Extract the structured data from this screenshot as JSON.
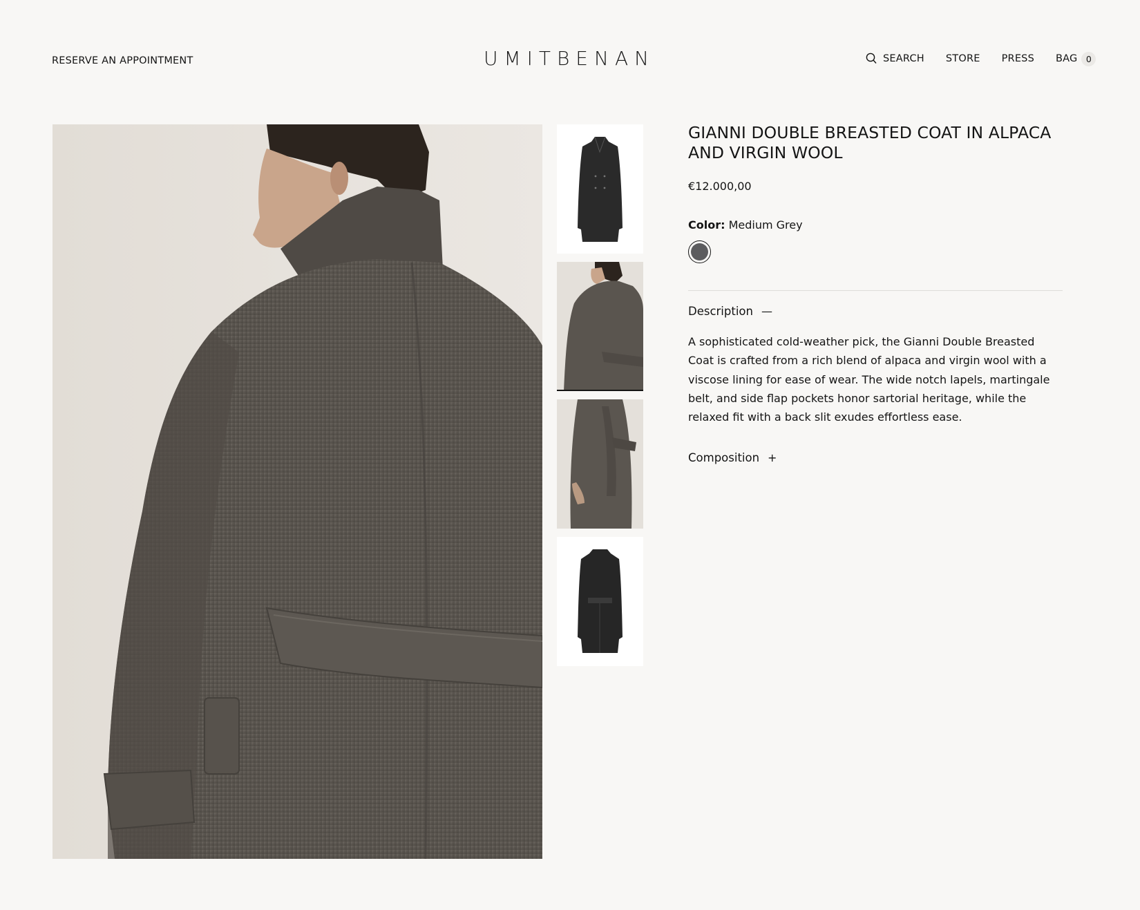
{
  "header": {
    "reserve_label": "RESERVE AN APPOINTMENT",
    "logo": "UMITBENAN",
    "nav": {
      "search_label": "SEARCH",
      "store_label": "STORE",
      "press_label": "PRESS",
      "bag_label": "BAG",
      "bag_count": "0"
    }
  },
  "gallery": {
    "main_image": "model-back-view-coat",
    "thumbnails": [
      {
        "name": "coat-front-flat"
      },
      {
        "name": "model-back-view",
        "active": true
      },
      {
        "name": "model-side-view"
      },
      {
        "name": "coat-back-flat"
      }
    ]
  },
  "product": {
    "title": "GIANNI DOUBLE BREASTED COAT IN ALPACA AND VIRGIN WOOL",
    "price": "€12.000,00",
    "color_label": "Color:",
    "color_value": "Medium Grey",
    "swatch_color": "#5c5c5e",
    "description": {
      "label": "Description",
      "sign": "—",
      "text": "A sophisticated cold-weather pick, the Gianni Double Breasted Coat is crafted from a rich blend of alpaca and virgin wool with a viscose lining for ease of wear. The wide notch lapels, martingale belt, and side flap pockets honor sartorial heritage, while the relaxed fit with a back slit exudes effortless ease."
    },
    "composition": {
      "label": "Composition",
      "sign": "+"
    }
  },
  "colors": {
    "background": "#f8f7f5",
    "text": "#141414",
    "coat": "#5a554f"
  }
}
